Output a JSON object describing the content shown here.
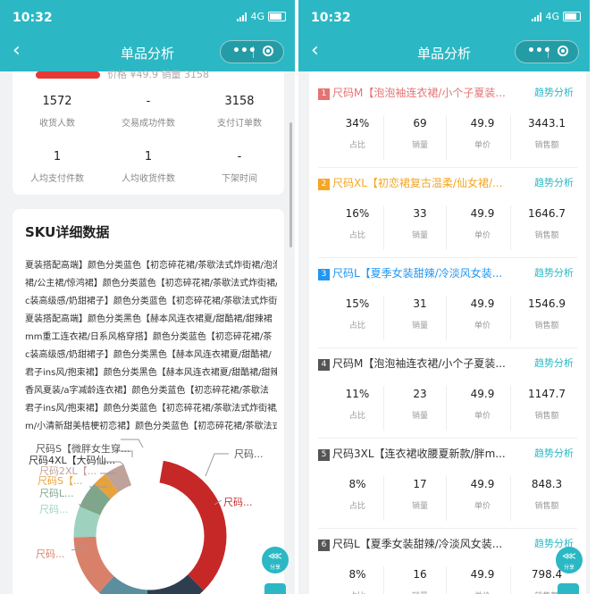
{
  "status": {
    "time": "10:32",
    "network": "4G"
  },
  "nav": {
    "title": "单品分析",
    "back_symbol": "‹",
    "more_symbol": "•••"
  },
  "colors": {
    "brand": "#2bb8c4",
    "red": "#e53935",
    "orange": "#f5a623",
    "blue": "#2196f3",
    "gray": "#555555"
  },
  "left": {
    "cut_text": "价格 ¥49.9  销量 3158",
    "stats_row1": [
      {
        "value": "1572",
        "label": "收货人数"
      },
      {
        "value": "-",
        "label": "交易成功件数"
      },
      {
        "value": "3158",
        "label": "支付订单数"
      }
    ],
    "stats_row2": [
      {
        "value": "1",
        "label": "人均支付件数"
      },
      {
        "value": "1",
        "label": "人均收货件数"
      },
      {
        "value": "-",
        "label": "下架时间"
      }
    ],
    "sku_title": "SKU详细数据",
    "sku_lines": [
      "夏装搭配高端】颜色分类蓝色【初恋碎花裙/茶歇法式炸街裙/泡泡",
      "裙/公主裙/惊鸿裙】颜色分类蓝色【初恋碎花裙/茶歇法式炸街裙/",
      "c装高级感/奶甜裙子】颜色分类蓝色【初恋碎花裙/茶歇法式炸街",
      "夏装搭配高端】颜色分类黑色【赫本风连衣裙夏/甜酷裙/甜辣裙",
      "mm重工连衣裙/日系风格穿搭】颜色分类蓝色【初恋碎花裙/茶",
      "c装高级感/奶甜裙子】颜色分类黑色【赫本风连衣裙夏/甜酷裙/",
      "君子ins风/抱束裙】颜色分类黑色【赫本风连衣裙夏/甜酷裙/甜辣",
      "香风夏装/a字减龄连衣裙】颜色分类蓝色【初恋碎花裙/茶歇法",
      "君子ins风/抱束裙】颜色分类蓝色【初恋碎花裙/茶歇法式炸街裙/",
      "m/小清新甜美桔梗初恋裙】颜色分类蓝色【初恋碎花裙/茶歇法式"
    ],
    "legend": [
      "尺码S【微胖女生穿...",
      "尺码4XL【大码仙...",
      "尺码2XL【...",
      "尺码S【...",
      "尺码L...",
      "尺码...",
      "尺码...",
      "尺码...",
      "尺码..."
    ],
    "share_label": "分享"
  },
  "right": {
    "metric_labels": [
      "占比",
      "销量",
      "单价",
      "销售额"
    ],
    "trend_label": "趋势分析",
    "products": [
      {
        "rank": "1",
        "title": "尺码M【泡泡袖连衣裙/小个子夏装...",
        "values": [
          "34%",
          "69",
          "49.9",
          "3443.1"
        ]
      },
      {
        "rank": "2",
        "title": "尺码XL【初恋裙复古温柔/仙女裙/...",
        "values": [
          "16%",
          "33",
          "49.9",
          "1646.7"
        ]
      },
      {
        "rank": "3",
        "title": "尺码L【夏季女装甜辣/冷淡风女装...",
        "values": [
          "15%",
          "31",
          "49.9",
          "1546.9"
        ]
      },
      {
        "rank": "4",
        "title": "尺码M【泡泡袖连衣裙/小个子夏装...",
        "values": [
          "11%",
          "23",
          "49.9",
          "1147.7"
        ]
      },
      {
        "rank": "5",
        "title": "尺码3XL【连衣裙收腰夏新款/胖m...",
        "values": [
          "8%",
          "17",
          "49.9",
          "848.3"
        ]
      },
      {
        "rank": "6",
        "title": "尺码L【夏季女装甜辣/冷淡风女装...",
        "values": [
          "8%",
          "16",
          "49.9",
          "798.4"
        ]
      }
    ],
    "share_label": "分享"
  }
}
